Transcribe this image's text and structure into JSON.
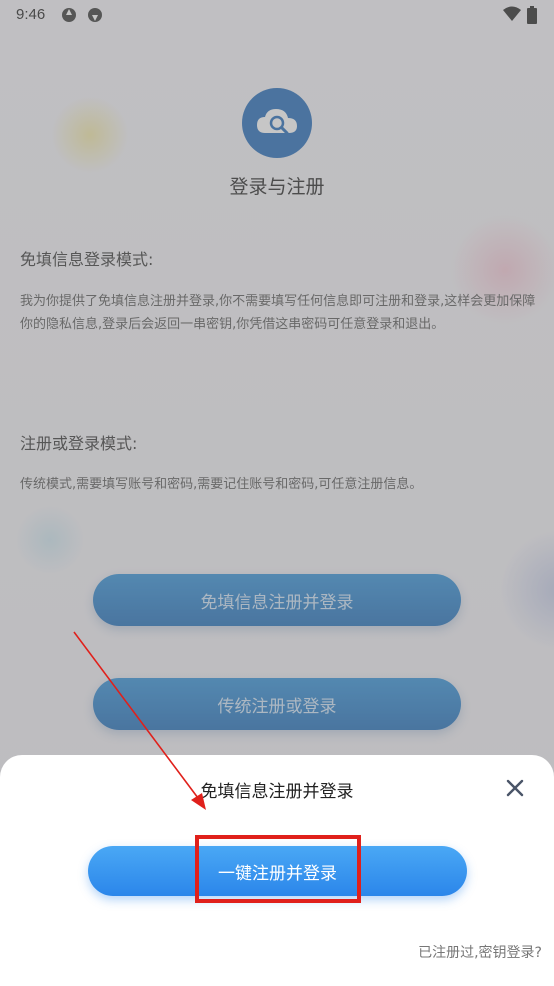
{
  "status_bar": {
    "time": "9:46"
  },
  "app": {
    "title": "登录与注册"
  },
  "sections": [
    {
      "title": "免填信息登录模式:",
      "body": "我为你提供了免填信息注册并登录,你不需要填写任何信息即可注册和登录,这样会更加保障你的隐私信息,登录后会返回一串密钥,你凭借这串密码可任意登录和退出。"
    },
    {
      "title": "注册或登录模式:",
      "body": "传统模式,需要填写账号和密码,需要记住账号和密码,可任意注册信息。"
    }
  ],
  "buttons": {
    "quick_register": "免填信息注册并登录",
    "traditional": "传统注册或登录"
  },
  "sheet": {
    "title": "免填信息注册并登录",
    "primary_button": "一键注册并登录",
    "secret_login_link": "已注册过,密钥登录?"
  },
  "colors": {
    "accent": "#2b86ea",
    "logo_bg": "#1f68b8",
    "highlight": "#e0201b"
  }
}
